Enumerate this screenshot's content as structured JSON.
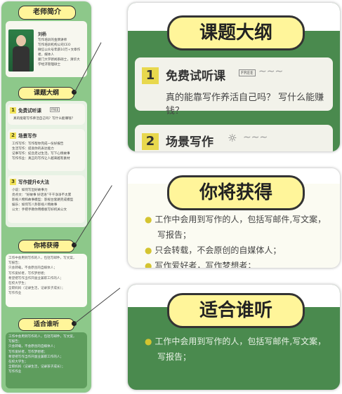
{
  "left": {
    "teacher_title": "老师简介",
    "teacher_name": "刘杨",
    "teacher_bio": [
      "写作培训的金牌讲师",
      "写作培训机构公司CEO",
      "微信公众号年薪10万+文章作",
      "者，媒体人",
      "厦门大学新闻系硕士，清华大",
      "学经济管理硕士"
    ],
    "outline_title": "课题大纲",
    "sections": [
      {
        "num": "1",
        "title": "免费试听课",
        "badge": "FREE",
        "lines": [
          "真的能靠写作养活自己吗？写什么能赚钱？"
        ]
      },
      {
        "num": "2",
        "title": "场景写作",
        "lines": [
          "工作写作：写作帮你完成一份好报告",
          "生活写作：提高你的表达能力",
          "记事写作：纪念走过生活，写下心情故事",
          "写作作业：真正的写作让人越来越有素材"
        ]
      },
      {
        "num": "3",
        "title": "写作提升6大法",
        "lines": [
          "小说：如何写出好故事力",
          "亮点文：“好故事 好话语”干干净净不太累",
          "影视人物和故事模型：影视台套路完成模型",
          "娱乐：如何写八卦影视人物故事",
          "公文：手把手教你用模板写好机关公文"
        ]
      }
    ],
    "gain_title": "你将获得",
    "gains": [
      "工作中会用到写作的人，包括写邮件，写文案，",
      "写报告；",
      "只会转载，不会原创的自媒体人；",
      "写作爱好者，写作梦想者；",
      "希望把写作当作开副业兼职工作的人；",
      "在校大学生；",
      "全职妈妈（记录生活，记录孩子成长）；",
      "写作作业"
    ],
    "fit_title": "适合谁听",
    "fits": [
      "工作中会用到写作的人，包括写邮件，写文案，",
      "写报告；",
      "只会转载，不会原创的自媒体人；",
      "写作爱好者，写作梦想者；",
      "希望把写作当作开副业兼职工作的人；",
      "在校大学生；",
      "全职妈妈（记录生活，记录孩子成长）；",
      "写作作业"
    ]
  },
  "zoom1": {
    "title": "课题大纲",
    "item1_num": "1",
    "item1_title": "免费试听课",
    "item1_badge": "FREE",
    "item1_desc": "真的能靠写作养活自己吗？ 写什么能赚钱？",
    "item2_num": "2",
    "item2_title": "场景写作"
  },
  "zoom2": {
    "title": "你将获得",
    "lines": [
      "工作中会用到写作的人，包括写邮件,写文案，",
      "写报告；",
      "只会转载，不会原创的自媒体人；",
      "写作爱好者，写作梦想者；"
    ]
  },
  "zoom3": {
    "title": "适合谁听",
    "lines": [
      "工作中会用到写作的人，包括写邮件,写文案，",
      "写报告；"
    ]
  },
  "colors": {
    "green": "#8dc88a",
    "dark_green": "#4c8a4f",
    "yellow": "#fff59a"
  }
}
